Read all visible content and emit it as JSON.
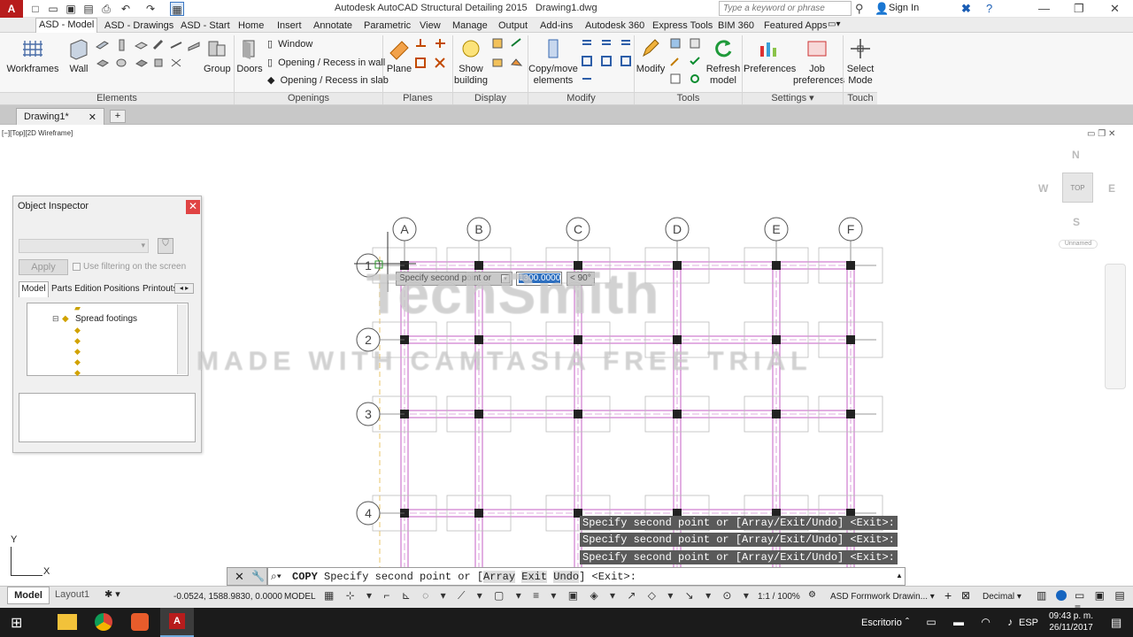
{
  "app": {
    "title": "Autodesk AutoCAD Structural Detailing 2015",
    "filename": "Drawing1.dwg",
    "logo_text": "A",
    "search_placeholder": "Type a keyword or phrase",
    "sign_in": "Sign In"
  },
  "ribbon_tabs": [
    "ASD - Model",
    "ASD - Drawings",
    "ASD - Start",
    "Home",
    "Insert",
    "Annotate",
    "Parametric",
    "View",
    "Manage",
    "Output",
    "Add-ins",
    "Autodesk 360",
    "Express Tools",
    "BIM 360",
    "Featured Apps"
  ],
  "ribbon": {
    "elements": {
      "label": "Elements",
      "workframes": "Workframes",
      "wall": "Wall",
      "group": "Group"
    },
    "openings": {
      "label": "Openings",
      "doors": "Doors",
      "window": "Window",
      "opening_wall": "Opening / Recess in wall",
      "opening_slab": "Opening / Recess in slab"
    },
    "planes": {
      "label": "Planes",
      "plane": "Plane"
    },
    "display": {
      "label": "Display",
      "show_building": "Show building"
    },
    "modify": {
      "label": "Modify",
      "copy_move": "Copy/move elements"
    },
    "tools": {
      "label": "Tools",
      "modify": "Modify",
      "refresh": "Refresh model"
    },
    "settings": {
      "label": "Settings",
      "preferences": "Preferences",
      "job_prefs": "Job preferences"
    },
    "touch": {
      "label": "Touch",
      "select_mode": "Select Mode"
    }
  },
  "doc_tab": "Drawing1*",
  "viewport_label": "[−][Top][2D Wireframe]",
  "viewcube": {
    "n": "N",
    "s": "S",
    "e": "E",
    "w": "W",
    "top": "TOP",
    "ucs": "Unnamed"
  },
  "object_inspector": {
    "title": "Object Inspector",
    "apply": "Apply",
    "filter_label": "Use filtering on the screen",
    "tabs": [
      "Model",
      "Parts Edition",
      "Positions",
      "Printouts"
    ],
    "tree_node": "Spread footings"
  },
  "grid": {
    "columns": [
      "A",
      "B",
      "C",
      "D",
      "E",
      "F"
    ],
    "rows": [
      "1",
      "2",
      "3",
      "4"
    ]
  },
  "tooltip": {
    "prompt": "Specify second point or",
    "value": "1300.0000",
    "angle": "< 90°"
  },
  "history": [
    "Specify second point or [Array/Exit/Undo] <Exit>:",
    "Specify second point or [Array/Exit/Undo] <Exit>:",
    "Specify second point or [Array/Exit/Undo] <Exit>:"
  ],
  "command": {
    "prefix": "COPY",
    "text": "Specify second point or [",
    "opt1": "Array",
    "opt2": "Exit",
    "opt3": "Undo",
    "suffix": "] <Exit>:"
  },
  "status": {
    "model_tab": "Model",
    "layout_tab": "Layout1",
    "coords": "-0.0524, 1588.9830, 0.0000",
    "space": "MODEL",
    "scale": "1:1 / 100%",
    "workspace": "ASD Formwork Drawin...",
    "units": "Decimal"
  },
  "ucs": {
    "y": "Y",
    "x": "X"
  },
  "watermark": {
    "brand": "TechSmith",
    "line": "MADE WITH CAMTASIA FREE TRIAL"
  },
  "taskbar": {
    "desktop": "Escritorio",
    "lang": "ESP",
    "time": "09:43 p. m.",
    "date": "26/11/2017"
  }
}
